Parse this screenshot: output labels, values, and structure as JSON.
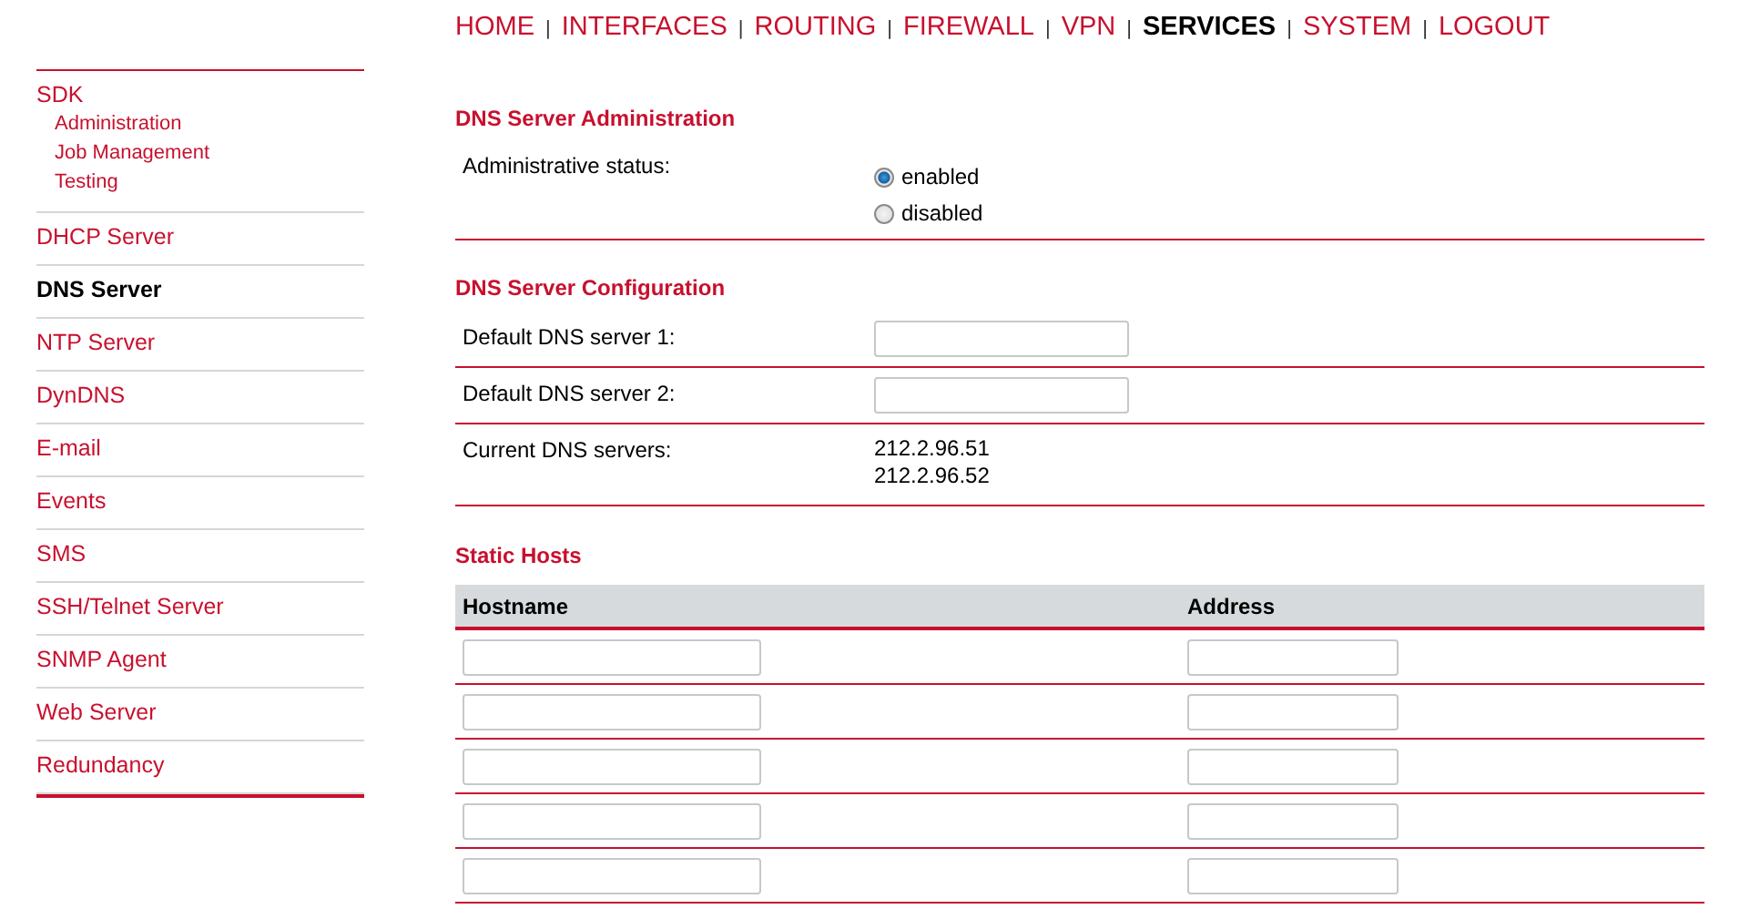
{
  "nav": [
    {
      "label": "HOME",
      "selected": false
    },
    {
      "label": "INTERFACES",
      "selected": false
    },
    {
      "label": "ROUTING",
      "selected": false
    },
    {
      "label": "FIREWALL",
      "selected": false
    },
    {
      "label": "VPN",
      "selected": false
    },
    {
      "label": "SERVICES",
      "selected": true
    },
    {
      "label": "SYSTEM",
      "selected": false
    },
    {
      "label": "LOGOUT",
      "selected": false
    }
  ],
  "nav_separator": "|",
  "sidebar": {
    "items": [
      {
        "label": "SDK",
        "selected": false,
        "children": [
          {
            "label": "Administration"
          },
          {
            "label": "Job Management"
          },
          {
            "label": "Testing"
          }
        ]
      },
      {
        "label": "DHCP Server",
        "selected": false
      },
      {
        "label": "DNS Server",
        "selected": true
      },
      {
        "label": "NTP Server",
        "selected": false
      },
      {
        "label": "DynDNS",
        "selected": false
      },
      {
        "label": "E-mail",
        "selected": false
      },
      {
        "label": "Events",
        "selected": false
      },
      {
        "label": "SMS",
        "selected": false
      },
      {
        "label": "SSH/Telnet Server",
        "selected": false
      },
      {
        "label": "SNMP Agent",
        "selected": false
      },
      {
        "label": "Web Server",
        "selected": false
      },
      {
        "label": "Redundancy",
        "selected": false
      }
    ]
  },
  "administration": {
    "title": "DNS Server Administration",
    "label": "Administrative status:",
    "options": [
      {
        "label": "enabled",
        "selected": true
      },
      {
        "label": "disabled",
        "selected": false
      }
    ]
  },
  "configuration": {
    "title": "DNS Server Configuration",
    "rows": [
      {
        "kind": "input",
        "label": "Default DNS server 1:"
      },
      {
        "kind": "input",
        "label": "Default DNS server 2:"
      },
      {
        "kind": "text",
        "label": "Current DNS servers:",
        "lines": [
          "212.2.96.51",
          "212.2.96.52"
        ]
      }
    ]
  },
  "static_hosts": {
    "title": "Static Hosts",
    "columns": [
      "Hostname",
      "Address"
    ],
    "rows": [
      {
        "kind": "input"
      },
      {
        "kind": "input"
      },
      {
        "kind": "input"
      },
      {
        "kind": "input"
      },
      {
        "kind": "input"
      }
    ]
  }
}
